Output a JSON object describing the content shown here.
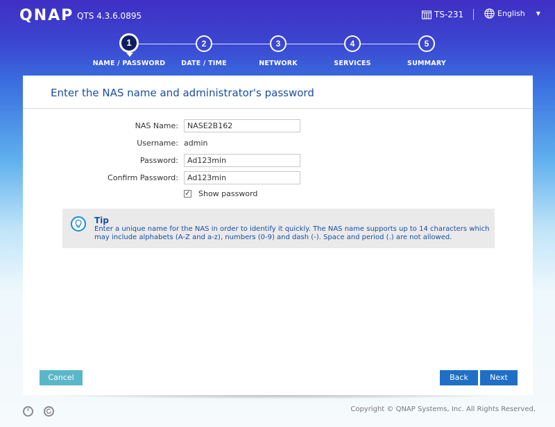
{
  "header": {
    "brand": "QNAP",
    "version": "QTS 4.3.6.0895",
    "model": "TS-231",
    "language": "English"
  },
  "steps": [
    {
      "number": "1",
      "label": "NAME / PASSWORD",
      "active": true
    },
    {
      "number": "2",
      "label": "DATE / TIME",
      "active": false
    },
    {
      "number": "3",
      "label": "NETWORK",
      "active": false
    },
    {
      "number": "4",
      "label": "SERVICES",
      "active": false
    },
    {
      "number": "5",
      "label": "SUMMARY",
      "active": false
    }
  ],
  "panel": {
    "title": "Enter the NAS name and administrator's password",
    "form": {
      "nas_name_label": "NAS Name:",
      "nas_name_value": "NASE2B162",
      "username_label": "Username:",
      "username_value": "admin",
      "password_label": "Password:",
      "password_value": "Ad123min",
      "confirm_label": "Confirm Password:",
      "confirm_value": "Ad123min",
      "show_password_label": "Show password",
      "show_password_checked": true
    },
    "tip": {
      "title": "Tip",
      "text": "Enter a unique name for the NAS in order to identify it quickly. The NAS name supports up to 14 characters which may include alphabets (A-Z and a-z), numbers (0-9) and dash (-). Space and period (.) are not allowed."
    },
    "buttons": {
      "cancel": "Cancel",
      "back": "Back",
      "next": "Next"
    }
  },
  "footer": {
    "copyright": "Copyright © QNAP Systems, Inc. All Rights Reserved.",
    "icons": [
      "power-icon",
      "restart-icon"
    ]
  },
  "colors": {
    "accent": "#1a4ea0",
    "button_primary": "#1f6fc6",
    "button_cancel": "#5ab7c9",
    "step_active": "#0f1e5e"
  }
}
